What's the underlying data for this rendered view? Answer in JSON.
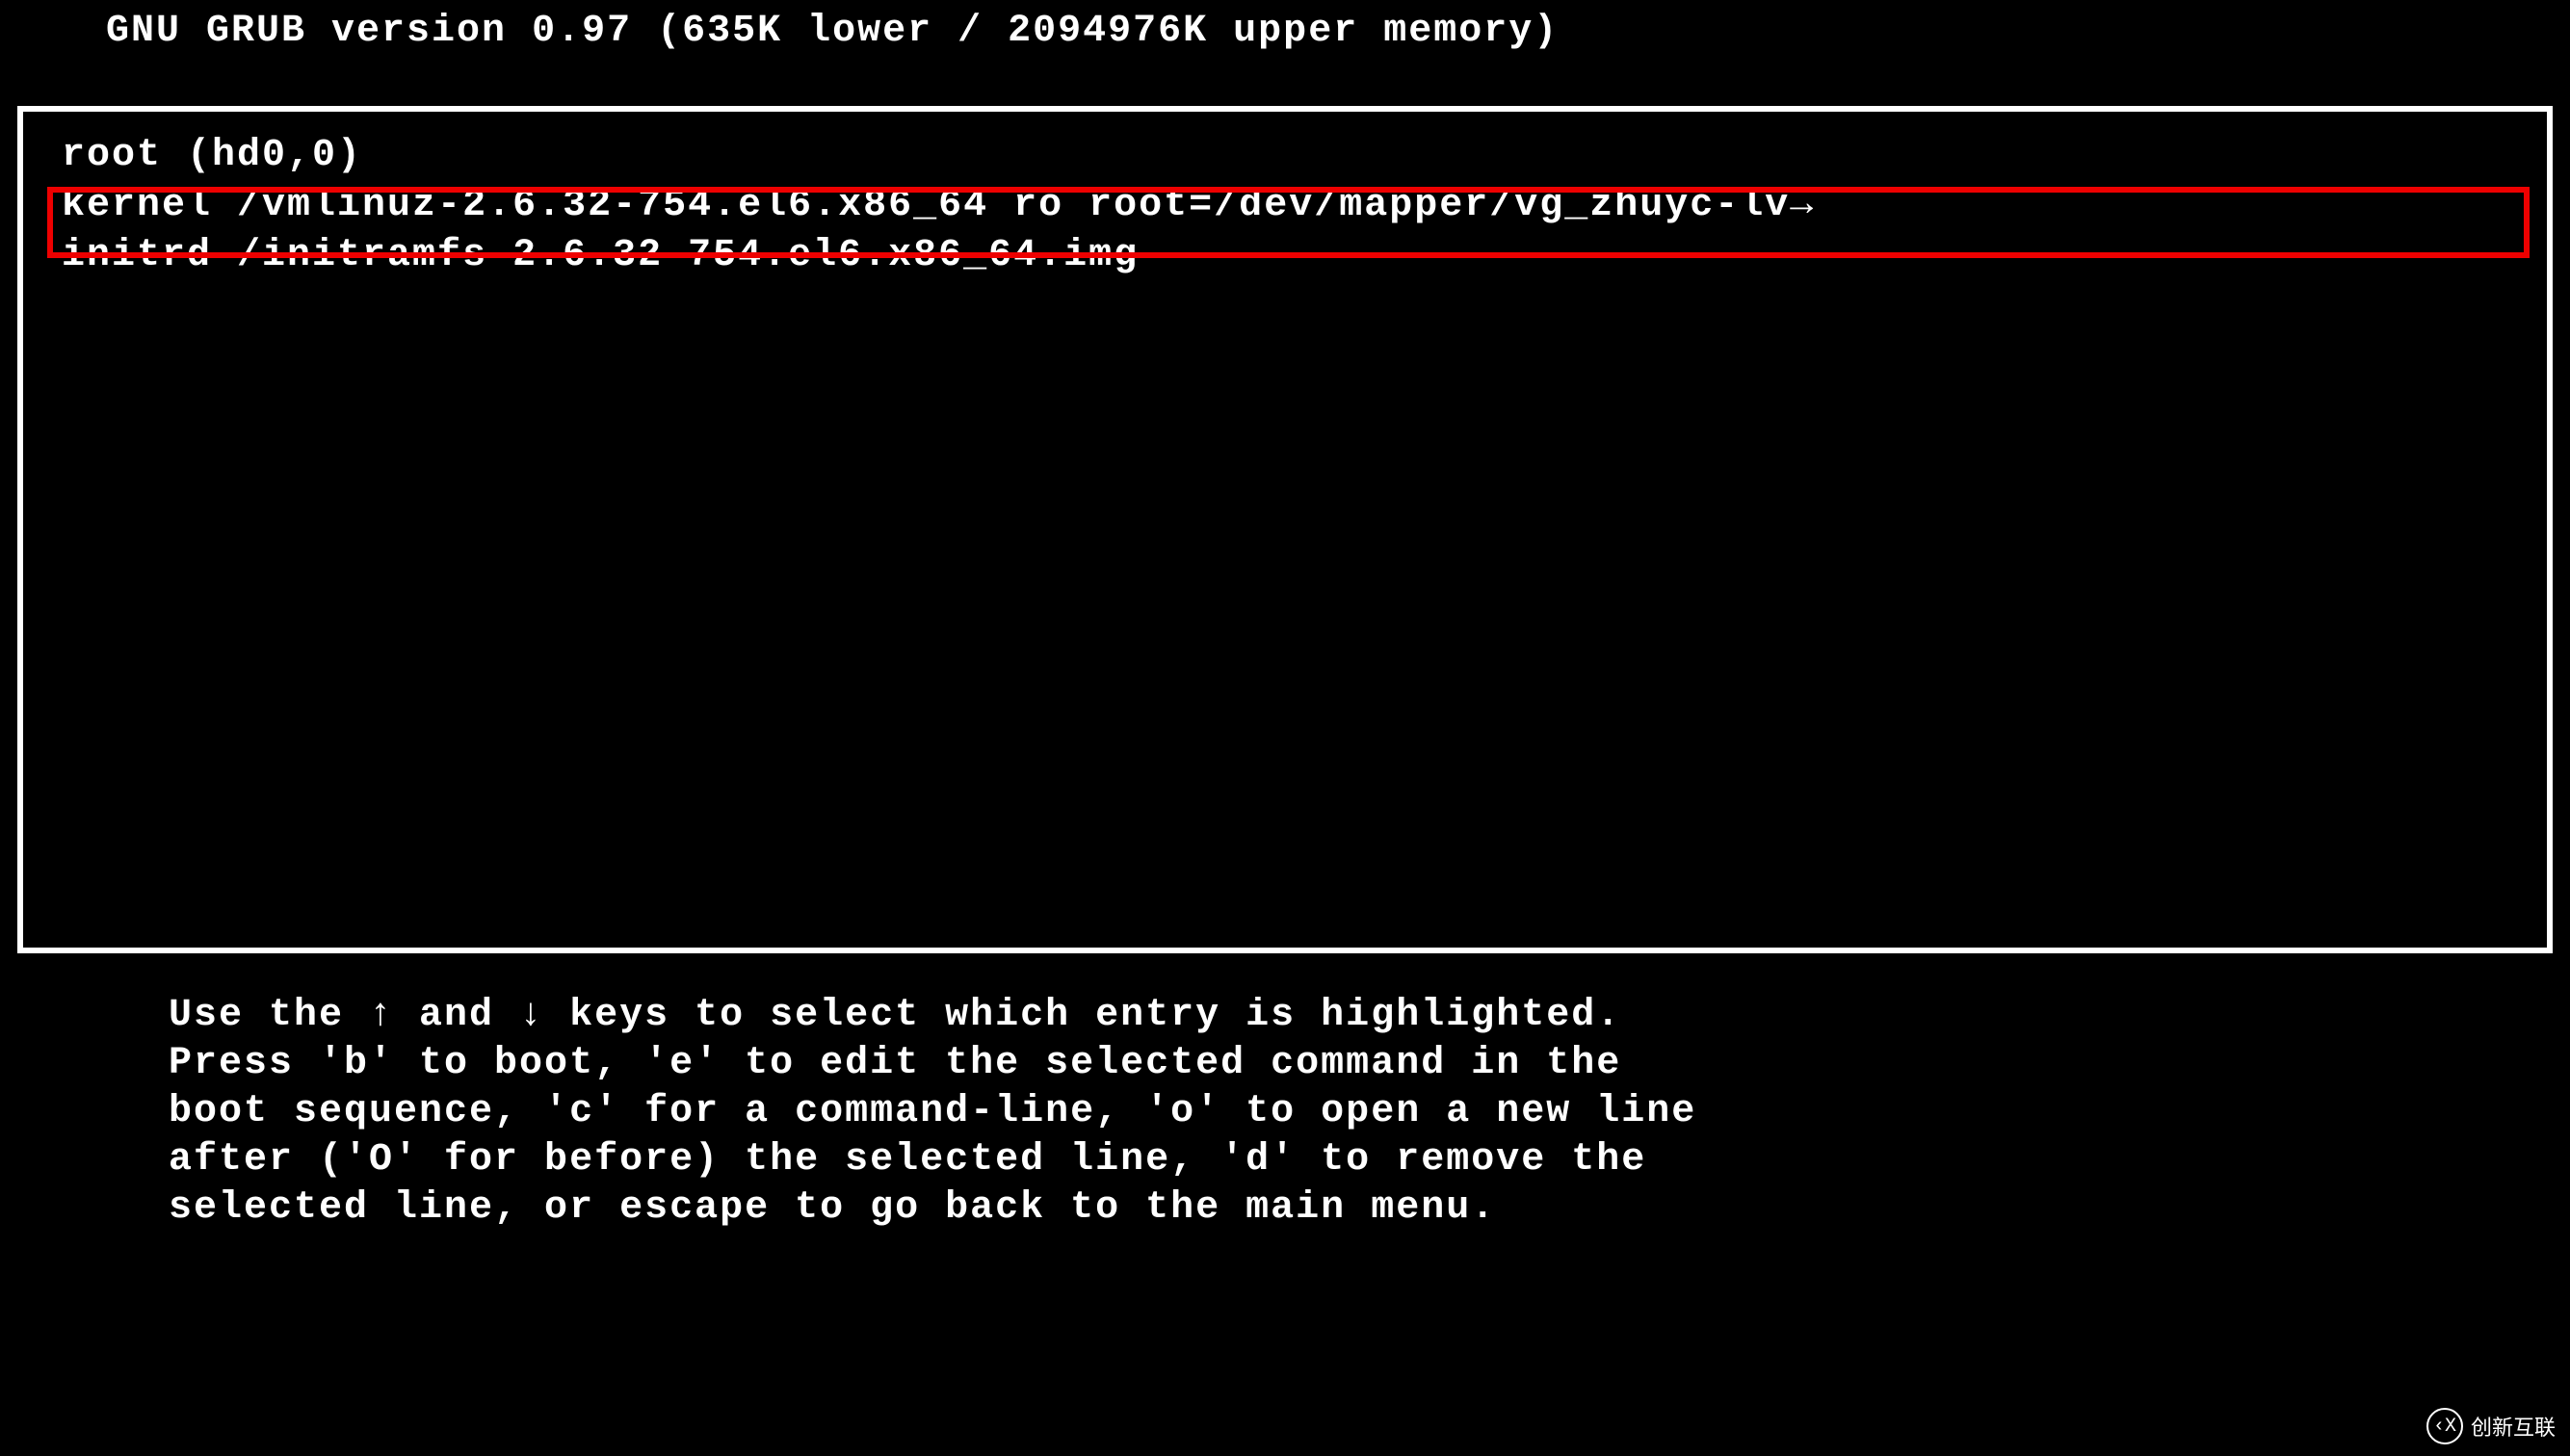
{
  "header": {
    "title": "GNU GRUB  version 0.97  (635K lower / 2094976K upper memory)"
  },
  "menu": {
    "lines": [
      "root (hd0,0)",
      "kernel /vmlinuz-2.6.32-754.el6.x86_64 ro root=/dev/mapper/vg_zhuyc-lv→",
      "initrd /initramfs-2.6.32-754.el6.x86_64.img"
    ],
    "highlighted_index": 1
  },
  "instructions": {
    "line1": "Use the ↑ and ↓ keys to select which entry is highlighted.",
    "line2": "Press 'b' to boot, 'e' to edit the selected command in the",
    "line3": "boot sequence, 'c' for a command-line, 'o' to open a new line",
    "line4": "after ('O' for before) the selected line, 'd' to remove the",
    "line5": "selected line, or escape to go back to the main menu."
  },
  "watermark": {
    "icon": "‹X",
    "text": "创新互联"
  }
}
